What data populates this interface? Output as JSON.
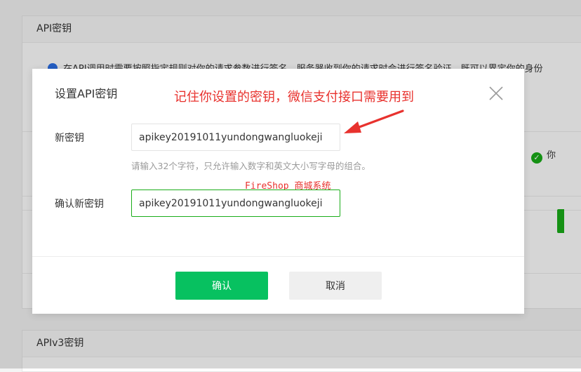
{
  "background": {
    "section1_title": "API密钥",
    "notice_text": "在API调用时需要按照指定规则对你的请求参数进行签名，服务器收到你的请求时会进行签名验证，既可以界定你的身份",
    "status_text": "你",
    "section2_title": "APIv3密钥"
  },
  "dialog": {
    "title": "设置API密钥",
    "annotation": "记住你设置的密钥，微信支付接口需要用到",
    "new_key_label": "新密钥",
    "new_key_value": "apikey20191011yundongwangluokeji",
    "hint": "请输入32个字符，只允许输入数字和英文大小写字母的组合。",
    "watermark": "FireShop 商城系统",
    "confirm_key_label": "确认新密钥",
    "confirm_key_value": "apikey20191011yundongwangluokeji",
    "confirm_button": "确认",
    "cancel_button": "取消"
  },
  "colors": {
    "accent_green": "#07c160",
    "annotation_red": "#e8322e"
  },
  "icons": [
    "info-icon",
    "check-circle-icon",
    "close-icon",
    "red-arrow-icon"
  ]
}
